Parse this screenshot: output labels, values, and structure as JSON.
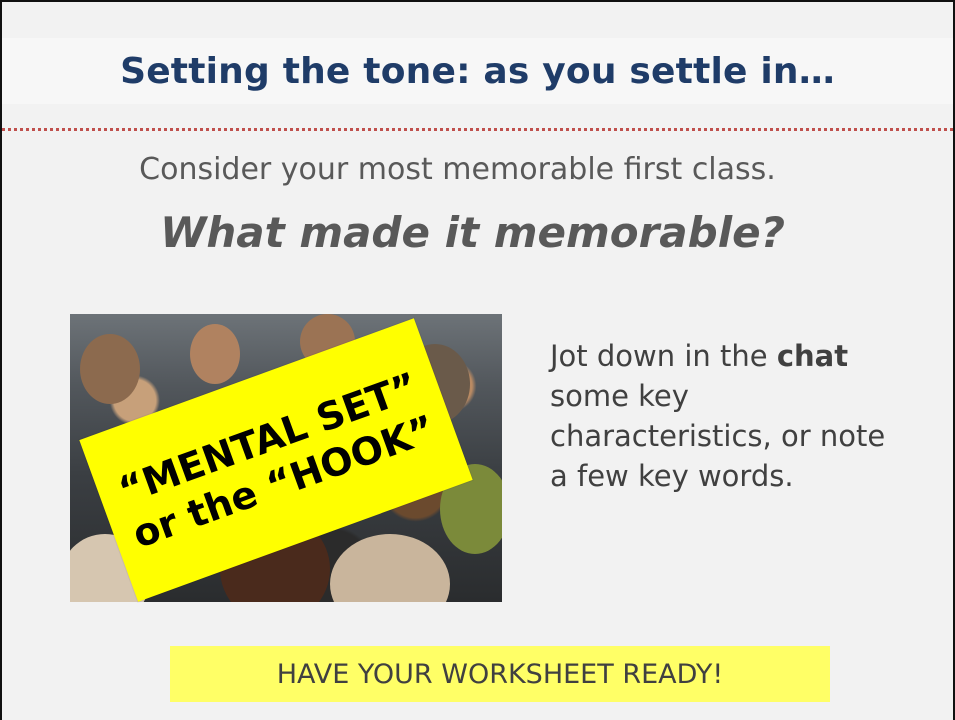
{
  "slide": {
    "title": "Setting the tone: as you settle in…",
    "prompt_line": "Consider your most memorable first class.",
    "question": "What made it memorable?",
    "photo_overlay": {
      "line1": "“MENTAL SET”",
      "line2": "or the “HOOK”"
    },
    "instruction": {
      "before": "Jot down in the ",
      "bold": "chat",
      "after": " some key characteristics, or note a few key words."
    },
    "banner": "HAVE YOUR WORKSHEET READY!"
  },
  "colors": {
    "title": "#1f3c68",
    "divider": "#c0504d",
    "highlight": "#ffff00",
    "banner": "#ffff66",
    "text": "#595959"
  }
}
